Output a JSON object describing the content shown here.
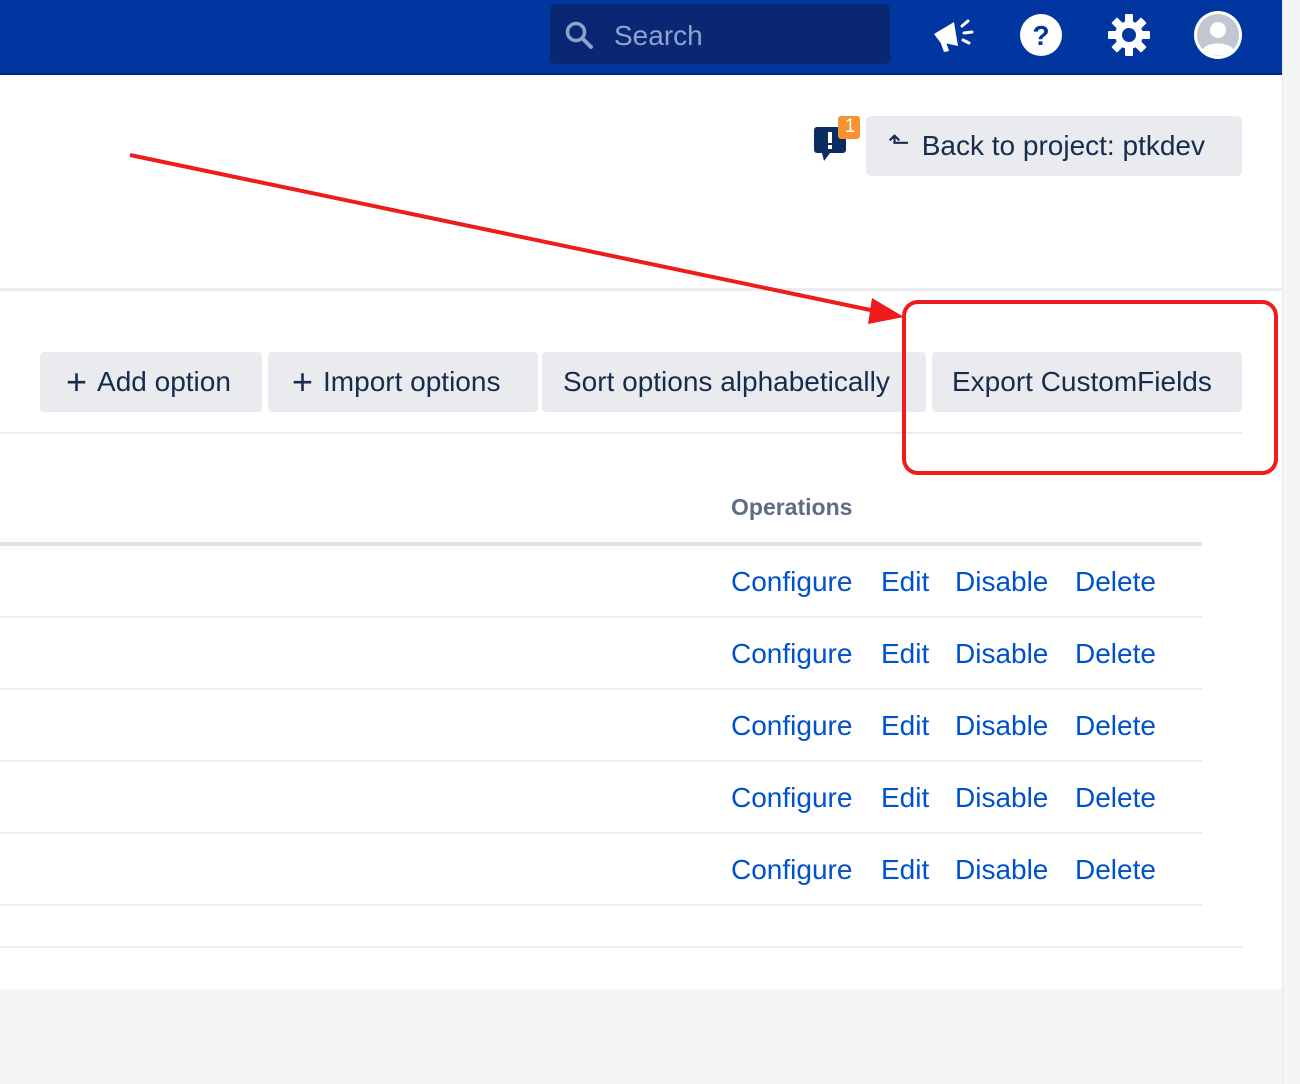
{
  "header": {
    "search_placeholder": "Search",
    "icons": [
      "search-icon",
      "megaphone-icon",
      "help-icon",
      "gear-icon",
      "avatar"
    ],
    "bg_color": "#0135a0"
  },
  "feedback": {
    "badge_count": "1"
  },
  "back_button": {
    "arrow": "⬑",
    "label": "Back to project: ptkdev"
  },
  "toolbar": {
    "add_option": "Add option",
    "import_options": "Import options",
    "sort_alpha": "Sort options alphabetically",
    "export_customfields": "Export CustomFields"
  },
  "table": {
    "operations_header": "Operations",
    "rows": [
      {
        "configure": "Configure",
        "edit": "Edit",
        "disable": "Disable",
        "delete": "Delete"
      },
      {
        "configure": "Configure",
        "edit": "Edit",
        "disable": "Disable",
        "delete": "Delete"
      },
      {
        "configure": "Configure",
        "edit": "Edit",
        "disable": "Disable",
        "delete": "Delete"
      },
      {
        "configure": "Configure",
        "edit": "Edit",
        "disable": "Disable",
        "delete": "Delete"
      },
      {
        "configure": "Configure",
        "edit": "Edit",
        "disable": "Disable",
        "delete": "Delete"
      }
    ]
  },
  "colors": {
    "link": "#0052cc",
    "annotation": "#ee1c1c"
  }
}
